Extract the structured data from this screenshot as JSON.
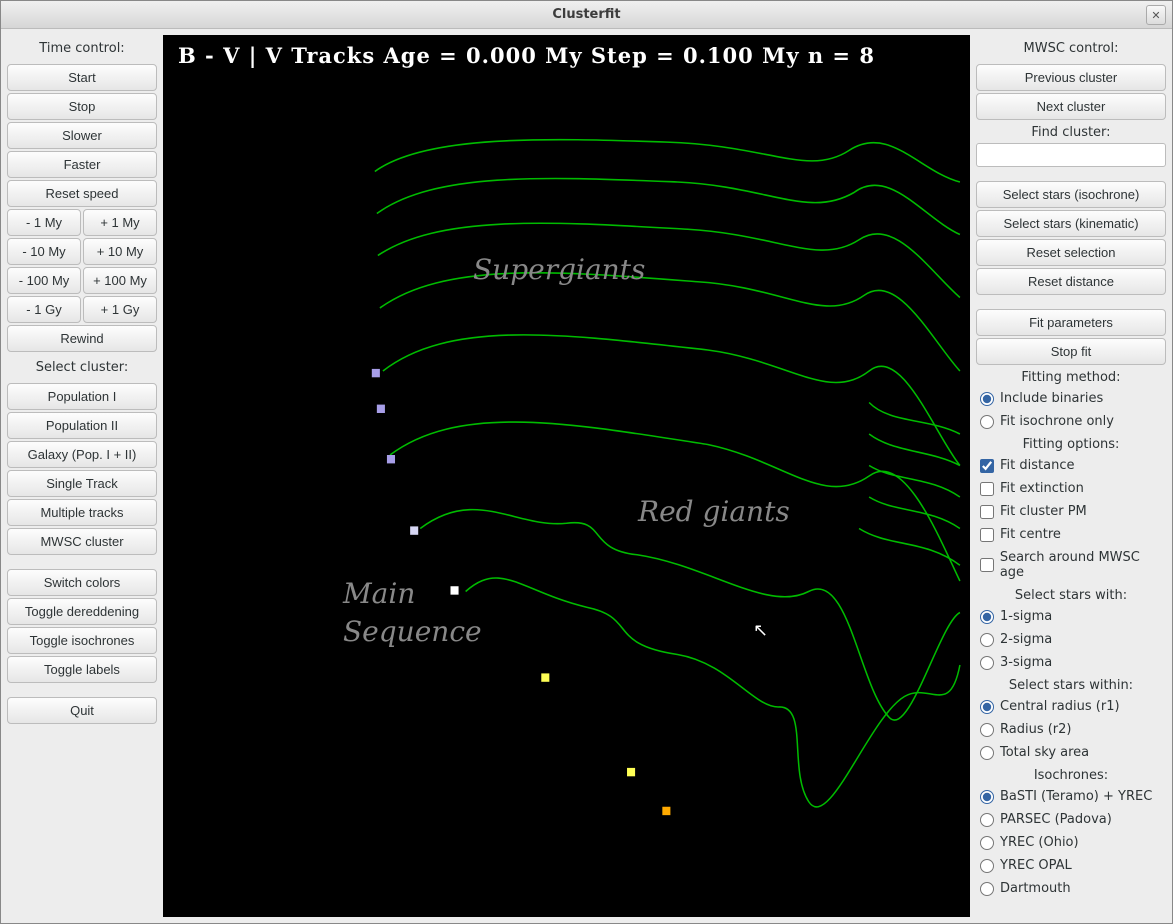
{
  "window": {
    "title": "Clusterfit"
  },
  "left": {
    "time_control_label": "Time control:",
    "start": "Start",
    "stop": "Stop",
    "slower": "Slower",
    "faster": "Faster",
    "reset_speed": "Reset speed",
    "minus_1my": "- 1 My",
    "plus_1my": "+ 1 My",
    "minus_10my": "- 10 My",
    "plus_10my": "+ 10 My",
    "minus_100my": "- 100 My",
    "plus_100my": "+ 100 My",
    "minus_1gy": "- 1 Gy",
    "plus_1gy": "+ 1 Gy",
    "rewind": "Rewind",
    "select_cluster_label": "Select cluster:",
    "pop1": "Population I",
    "pop2": "Population II",
    "galaxy": "Galaxy (Pop. I + II)",
    "single_track": "Single Track",
    "multiple_tracks": "Multiple tracks",
    "mwsc_cluster": "MWSC cluster",
    "switch_colors": "Switch colors",
    "toggle_dered": "Toggle dereddening",
    "toggle_iso": "Toggle isochrones",
    "toggle_labels": "Toggle labels",
    "quit": "Quit"
  },
  "right": {
    "mwsc_control_label": "MWSC control:",
    "previous_cluster": "Previous cluster",
    "next_cluster": "Next cluster",
    "find_cluster_label": "Find cluster:",
    "find_cluster_value": "",
    "select_iso": "Select stars (isochrone)",
    "select_kin": "Select stars (kinematic)",
    "reset_selection": "Reset selection",
    "reset_distance": "Reset distance",
    "fit_parameters": "Fit parameters",
    "stop_fit": "Stop fit",
    "fitting_method_label": "Fitting method:",
    "include_binaries": "Include binaries",
    "fit_isochrone_only": "Fit isochrone only",
    "fitting_options_label": "Fitting options:",
    "fit_distance": "Fit distance",
    "fit_extinction": "Fit extinction",
    "fit_cluster_pm": "Fit cluster PM",
    "fit_centre": "Fit centre",
    "search_mwsc_age": "Search around MWSC age",
    "select_stars_with_label": "Select stars with:",
    "sigma1": "1-sigma",
    "sigma2": "2-sigma",
    "sigma3": "3-sigma",
    "select_within_label": "Select stars within:",
    "r1": "Central radius (r1)",
    "r2": "Radius (r2)",
    "total_sky": "Total sky area",
    "isochrones_label": "Isochrones:",
    "basti": "BaSTI (Teramo) + YREC",
    "parsec": "PARSEC (Padova)",
    "yrec": "YREC (Ohio)",
    "yrec_opal": "YREC OPAL",
    "dartmouth": "Dartmouth"
  },
  "plot": {
    "title": "B - V | V  Tracks  Age = 0.000 My  Step = 0.100 My  n = 8",
    "label_supergiants": "Supergiants",
    "label_redgiants": "Red giants",
    "label_mainseq1": "Main",
    "label_mainseq2": "Sequence"
  },
  "chart_data": {
    "type": "line",
    "title": "B - V | V  Tracks  Age = 0.000 My  Step = 0.100 My  n = 8",
    "xlabel": "B - V",
    "ylabel": "V",
    "parameters": {
      "age_my": 0.0,
      "step_my": 0.1,
      "n": 8
    },
    "annotations": [
      "Supergiants",
      "Red giants",
      "Main Sequence"
    ],
    "series_note": "8 stellar evolutionary tracks (green curves); start markers at bright end; no numeric axis ticks visible"
  }
}
